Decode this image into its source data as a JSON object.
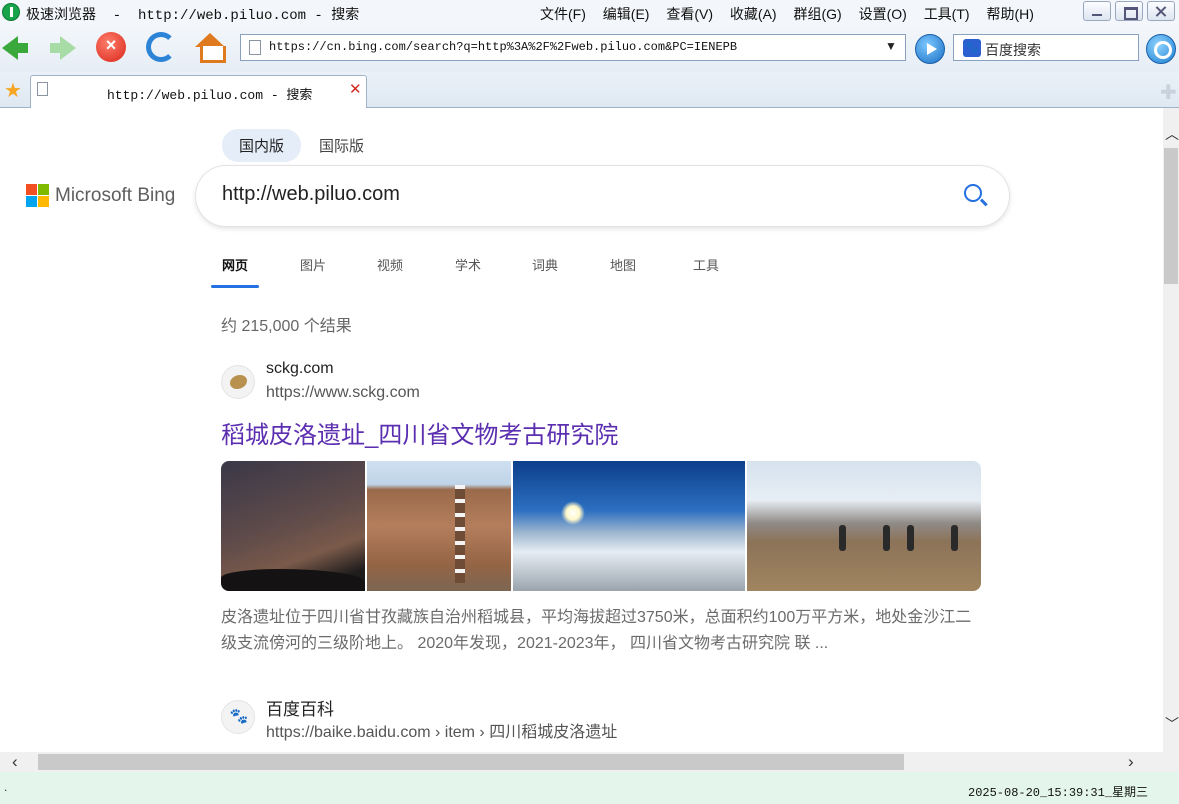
{
  "window": {
    "title": "极速浏览器  -  http://web.piluo.com - 搜索",
    "menu": [
      "文件(F)",
      "编辑(E)",
      "查看(V)",
      "收藏(A)",
      "群组(G)",
      "设置(O)",
      "工具(T)",
      "帮助(H)"
    ]
  },
  "toolbar": {
    "address": "https://cn.bing.com/search?q=http%3A%2F%2Fweb.piluo.com&PC=IENEPB",
    "search_engine_text": "百度搜索"
  },
  "tabs": [
    {
      "title": "http://web.piluo.com - 搜索"
    }
  ],
  "bing": {
    "region_toggle": [
      "国内版",
      "国际版"
    ],
    "brand": "Microsoft Bing",
    "query": "http://web.piluo.com",
    "scopes": [
      "网页",
      "图片",
      "视频",
      "学术",
      "词典",
      "地图",
      "工具"
    ],
    "result_count": "约 215,000 个结果",
    "results": [
      {
        "site": "sckg.com",
        "url": "https://www.sckg.com",
        "title": "稻城皮洛遗址_四川省文物考古研究院",
        "snippet": "皮洛遗址位于四川省甘孜藏族自治州稻城县，平均海拔超过3750米，总面积约100万平方米，地处金沙江二级支流傍河的三级阶地上。 2020年发现，2021-2023年， 四川省文物考古研究院 联 ..."
      },
      {
        "site": "百度百科",
        "url": "https://baike.baidu.com › item › 四川稻城皮洛遗址"
      }
    ]
  },
  "status": {
    "left": ".",
    "clock": "2025-08-20_15:39:31_星期三"
  }
}
